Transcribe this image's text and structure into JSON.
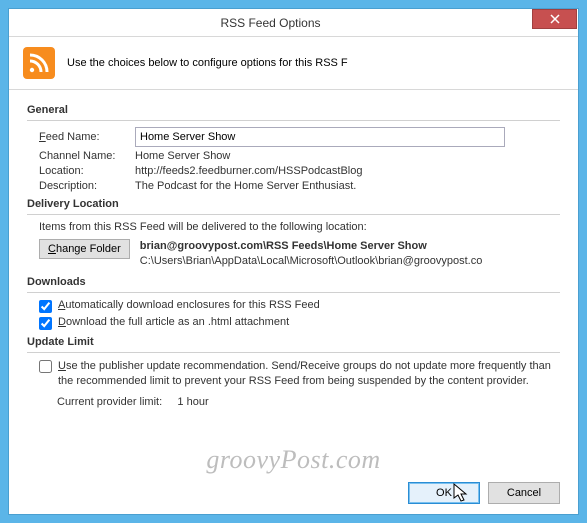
{
  "title": "RSS Feed Options",
  "header_hint": "Use the choices below to configure options for this RSS F",
  "sections": {
    "general": {
      "heading": "General",
      "feed_name_label": "Feed Name:",
      "feed_name_value": "Home Server Show",
      "channel_name_label": "Channel Name:",
      "channel_name_value": "Home Server Show",
      "location_label": "Location:",
      "location_value": "http://feeds2.feedburner.com/HSSPodcastBlog",
      "description_label": "Description:",
      "description_value": "The Podcast for the Home Server Enthusiast."
    },
    "delivery": {
      "heading": "Delivery Location",
      "note": "Items from this RSS Feed will be delivered to the following location:",
      "change_btn": "Change Folder",
      "path_bold": "brian@groovypost.com\\RSS Feeds\\Home Server Show",
      "path_small": "C:\\Users\\Brian\\AppData\\Local\\Microsoft\\Outlook\\brian@groovypost.co"
    },
    "downloads": {
      "heading": "Downloads",
      "opt1": "Automatically download enclosures for this RSS Feed",
      "opt2": "Download the full article as an .html attachment"
    },
    "update": {
      "heading": "Update Limit",
      "text": "Use the publisher update recommendation. Send/Receive groups do not update more frequently than the recommended limit to prevent your RSS Feed from being suspended by the content provider.",
      "current_label": "Current provider limit:",
      "current_value": "1 hour"
    }
  },
  "buttons": {
    "ok": "OK",
    "cancel": "Cancel"
  },
  "watermark": "groovyPost.com"
}
